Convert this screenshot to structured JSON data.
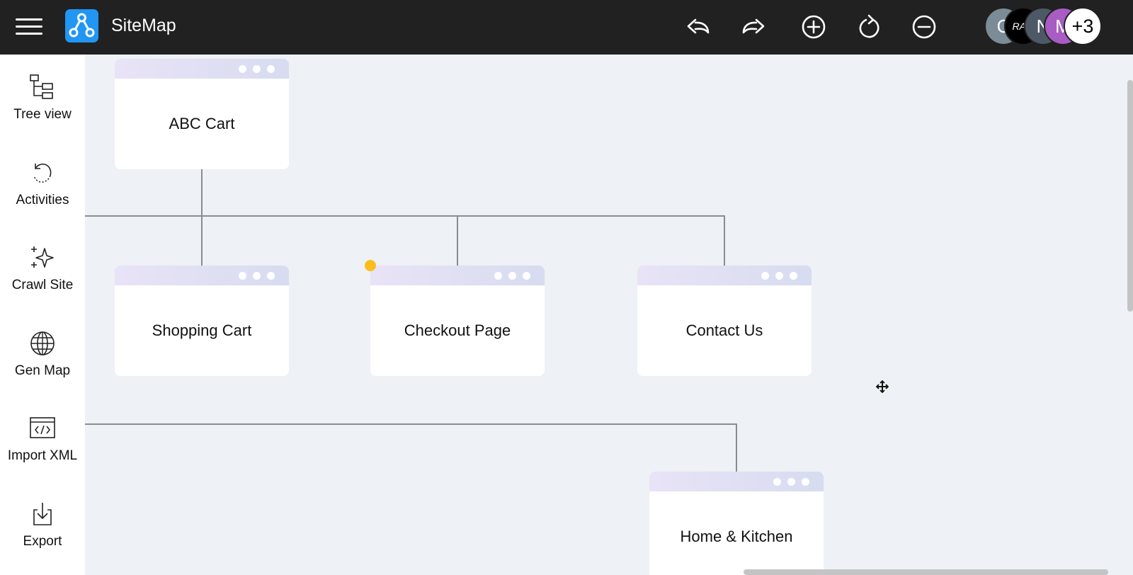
{
  "app": {
    "title": "SiteMap",
    "logo_icon": "sitemap-logo-icon",
    "accent_color": "#2196f3"
  },
  "toolbar": {
    "actions": [
      {
        "name": "undo",
        "icon": "undo-icon"
      },
      {
        "name": "redo",
        "icon": "redo-icon"
      },
      {
        "name": "zoom-in",
        "icon": "plus-circle-icon"
      },
      {
        "name": "refresh",
        "icon": "refresh-icon"
      },
      {
        "name": "zoom-out",
        "icon": "minus-circle-icon"
      }
    ]
  },
  "collaborators": {
    "avatars": [
      {
        "initial": "C",
        "color": "#7b8c97"
      },
      {
        "initial": "RAM",
        "color": "#000000"
      },
      {
        "initial": "N",
        "color": "#4d5a66"
      },
      {
        "initial": "M",
        "color": "#a85cc4"
      }
    ],
    "more_label": "+3"
  },
  "sidebar": {
    "items": [
      {
        "label": "Tree view",
        "icon": "tree-view-icon"
      },
      {
        "label": "Activities",
        "icon": "history-icon"
      },
      {
        "label": "Crawl Site",
        "icon": "sparkle-icon"
      },
      {
        "label": "Gen Map",
        "icon": "globe-icon"
      },
      {
        "label": "Import XML",
        "icon": "code-file-icon"
      },
      {
        "label": "Export",
        "icon": "download-icon"
      }
    ]
  },
  "canvas": {
    "nodes": [
      {
        "title": "ABC Cart"
      },
      {
        "title": "Shopping Cart"
      },
      {
        "title": "Checkout Page"
      },
      {
        "title": "Contact Us"
      },
      {
        "title": "Home & Kitchen"
      }
    ],
    "marker_color": "#fbbd1e"
  }
}
